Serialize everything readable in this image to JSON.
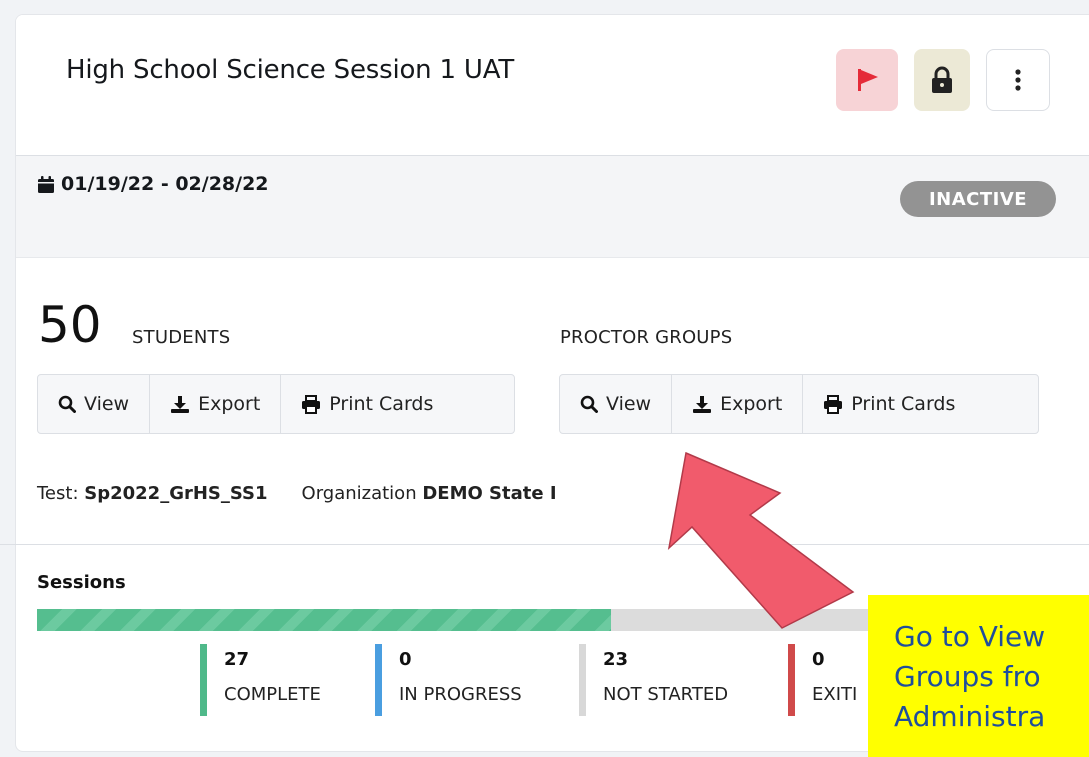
{
  "header": {
    "title": "High School Science Session 1 UAT",
    "icons": [
      "flag-icon",
      "lock-icon",
      "more-vertical-icon"
    ],
    "colors": {
      "flag_bg": "#f7d3d6",
      "flag": "#e52b39",
      "lock_bg": "#ece9d6"
    }
  },
  "date_bar": {
    "dates": "01/19/22 - 02/28/22",
    "status": "INACTIVE"
  },
  "students": {
    "count": "50",
    "label": "STUDENTS",
    "buttons": {
      "view": "View",
      "export": "Export",
      "print": "Print Cards"
    }
  },
  "proctor_groups": {
    "label": "PROCTOR GROUPS",
    "buttons": {
      "view": "View",
      "export": "Export",
      "print": "Print Cards"
    }
  },
  "meta": {
    "test_label": "Test:",
    "test_value": "Sp2022_GrHS_SS1",
    "org_label": "Organization",
    "org_value": "DEMO State I"
  },
  "sessions": {
    "label": "Sessions",
    "progress_complete_fraction": 0.54,
    "stats": [
      {
        "value": "27",
        "label": "COMPLETE",
        "color": "#4fb98a"
      },
      {
        "value": "0",
        "label": "IN PROGRESS",
        "color": "#4a9ee0"
      },
      {
        "value": "23",
        "label": "NOT STARTED",
        "color": "#d8d8d8"
      },
      {
        "value": "0",
        "label": "EXITI",
        "color": "#d04a4a"
      }
    ]
  },
  "callout": {
    "line1": "Go to View",
    "line2": "Groups fro",
    "line3": "Administra",
    "arrow_color": "#f15b6c"
  }
}
